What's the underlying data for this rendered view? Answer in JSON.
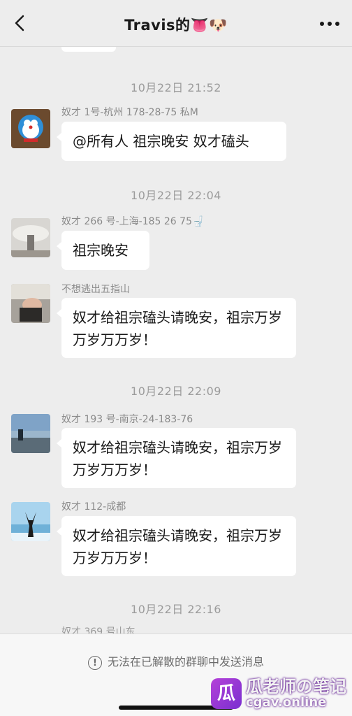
{
  "header": {
    "title": "Travis的👅🐶",
    "back_icon": "chevron-left-icon",
    "more_icon": "more-dots-icon"
  },
  "messages": [
    {
      "timestamp": "10月22日 21:52",
      "sender": "奴才 1号-杭州 178-28-75 私M",
      "text": "@所有人 祖宗晚安 奴才磕头"
    },
    {
      "timestamp": "10月22日 22:04",
      "sender": "奴才 266 号-上海-185 26 75🚽",
      "text": "祖宗晚安"
    },
    {
      "sender": "不想逃出五指山",
      "text": "奴才给祖宗磕头请晚安，祖宗万岁万岁万万岁！"
    },
    {
      "timestamp": "10月22日 22:09",
      "sender": "奴才 193 号-南京-24-183-76",
      "text": "奴才给祖宗磕头请晚安，祖宗万岁万岁万万岁！"
    },
    {
      "sender": "奴才 112-成都",
      "text": "奴才给祖宗磕头请晚安，祖宗万岁万岁万万岁！"
    },
    {
      "timestamp": "10月22日 22:16",
      "sender": "奴才 369 号山东"
    }
  ],
  "footer": {
    "notice": "无法在已解散的群聊中发送消息",
    "notice_icon": "exclamation-circle-icon"
  },
  "watermark": {
    "logo_char": "瓜",
    "title": "瓜老师の笔记",
    "domain": "cgav.online"
  }
}
